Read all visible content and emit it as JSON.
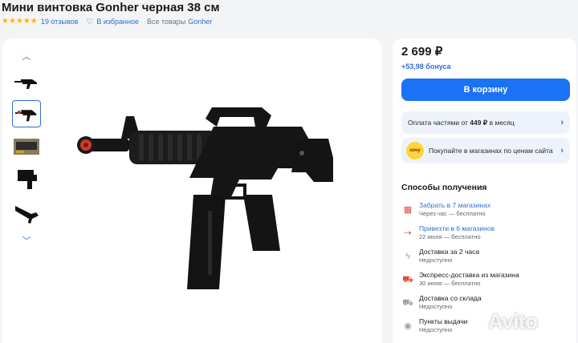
{
  "product": {
    "title": "Мини винтовка Gonher черная 38 см",
    "rating": 5,
    "reviews": "19 отзывов",
    "favorite": "В избранное",
    "all_goods_label": "Все товары",
    "brand": "Gonher"
  },
  "gallery": {
    "up_icon": "chevron-up-icon",
    "down_icon": "chevron-down-icon",
    "thumbnails": [
      "rifle-side-view",
      "rifle-side-view-selected",
      "rifle-box",
      "rifle-front-view",
      "rifle-angled-view"
    ],
    "selected_index": 1
  },
  "purchase": {
    "price": "2 699 ₽",
    "bonus": "+53,98 бонуса",
    "cart_button": "В корзину",
    "installments": {
      "prefix": "Оплата частями от ",
      "amount": "449 ₽",
      "suffix": " в месяц"
    },
    "store_price": {
      "badge": "хочу",
      "text": "Покупайте в магазинах по ценам сайта"
    }
  },
  "delivery": {
    "title": "Способы получения",
    "options": [
      {
        "icon": "store-icon",
        "title": "Забрать в 7 магазинах",
        "subtitle": "Через час — бесплатно",
        "link": true
      },
      {
        "icon": "pickup-point-icon",
        "title": "Привезти в 6 магазинов",
        "subtitle": "22 июля — бесплатно",
        "link": true
      },
      {
        "icon": "lightning-icon",
        "title": "Доставка за 2 часа",
        "subtitle": "Недоступно",
        "link": false
      },
      {
        "icon": "express-truck-icon",
        "title": "Экспресс-доставка из магазина",
        "subtitle": "30 июня — бесплатно",
        "link": false
      },
      {
        "icon": "warehouse-truck-icon",
        "title": "Доставка со склада",
        "subtitle": "Недоступно",
        "link": false
      },
      {
        "icon": "pickup-location-icon",
        "title": "Пункты выдачи",
        "subtitle": "Недоступно",
        "link": false
      }
    ]
  },
  "watermark": "Avito",
  "colors": {
    "accent": "#1a72f5",
    "link": "#2f6fd0",
    "star": "#ffb400",
    "background": "#f3f4f6"
  }
}
